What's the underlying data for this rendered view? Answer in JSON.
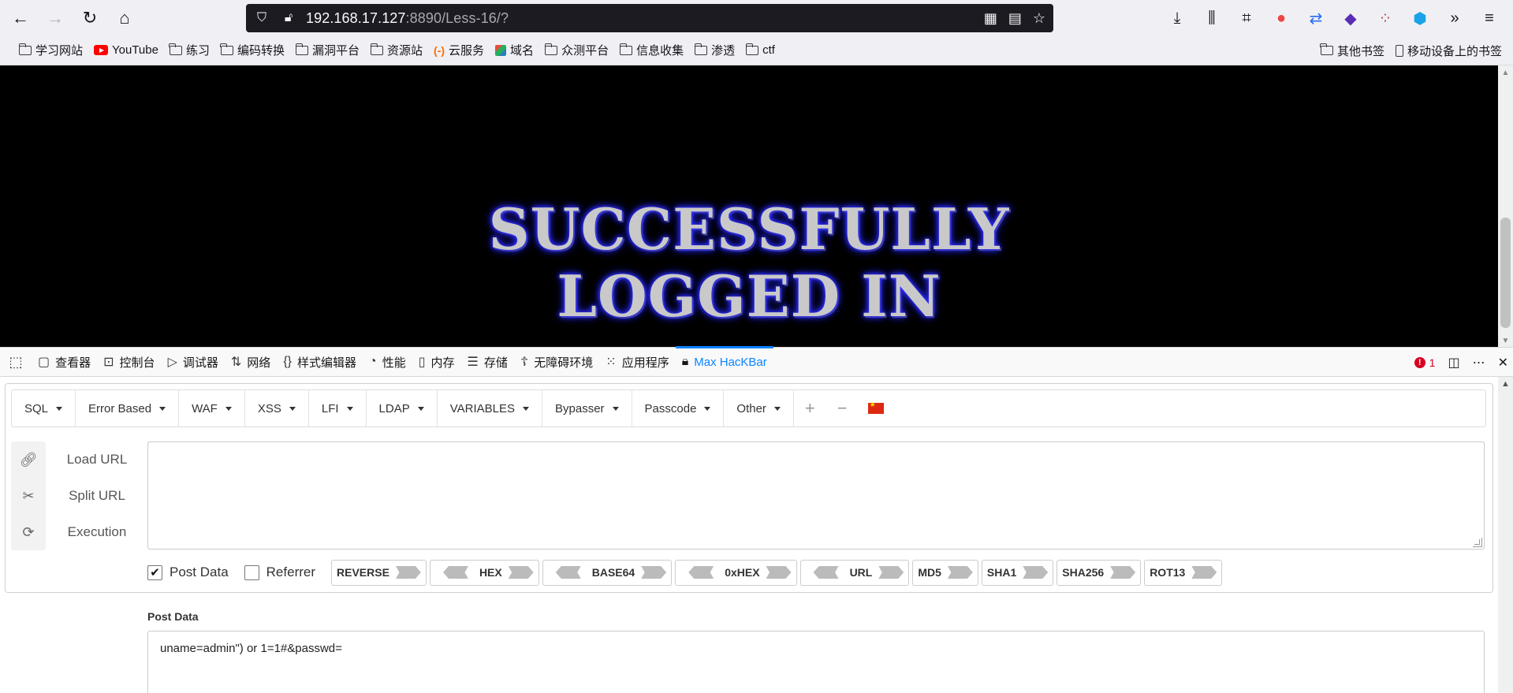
{
  "browser": {
    "url_host": "192.168.17.127",
    "url_rest": ":8890/Less-16/?"
  },
  "bookmarks": {
    "left": [
      {
        "label": "学习网站",
        "icon": "folder-icon"
      },
      {
        "label": "YouTube",
        "icon": "youtube-icon"
      },
      {
        "label": "练习",
        "icon": "folder-icon"
      },
      {
        "label": "编码转换",
        "icon": "folder-icon"
      },
      {
        "label": "漏洞平台",
        "icon": "folder-icon"
      },
      {
        "label": "资源站",
        "icon": "folder-icon"
      },
      {
        "label": "云服务",
        "icon": "cloud-icon"
      },
      {
        "label": "域名",
        "icon": "cube-icon"
      },
      {
        "label": "众测平台",
        "icon": "folder-icon"
      },
      {
        "label": "信息收集",
        "icon": "folder-icon"
      },
      {
        "label": "渗透",
        "icon": "folder-icon"
      },
      {
        "label": "ctf",
        "icon": "folder-icon"
      }
    ],
    "other": "其他书签",
    "mobile": "移动设备上的书签"
  },
  "page": {
    "line1": "SUCCESSFULLY",
    "line2": "LOGGED IN"
  },
  "devtools": {
    "tabs": [
      {
        "label": "查看器",
        "icon": "inspector-icon"
      },
      {
        "label": "控制台",
        "icon": "console-icon"
      },
      {
        "label": "调试器",
        "icon": "debugger-icon"
      },
      {
        "label": "网络",
        "icon": "network-icon"
      },
      {
        "label": "样式编辑器",
        "icon": "style-editor-icon"
      },
      {
        "label": "性能",
        "icon": "performance-icon"
      },
      {
        "label": "内存",
        "icon": "memory-icon"
      },
      {
        "label": "存储",
        "icon": "storage-icon"
      },
      {
        "label": "无障碍环境",
        "icon": "accessibility-icon"
      },
      {
        "label": "应用程序",
        "icon": "application-icon"
      },
      {
        "label": "Max HacKBar",
        "icon": "hackbar-icon"
      }
    ],
    "active_tab": "Max HacKBar",
    "error_count": "1",
    "accent_color": "#0a84ff"
  },
  "hackbar": {
    "menu": [
      "SQL",
      "Error Based",
      "WAF",
      "XSS",
      "LFI",
      "LDAP",
      "VARIABLES",
      "Bypasser",
      "Passcode",
      "Other"
    ],
    "actions": [
      {
        "label": "Load URL",
        "icon": "link-icon"
      },
      {
        "label": "Split URL",
        "icon": "scissors-icon"
      },
      {
        "label": "Execution",
        "icon": "refresh-icon"
      }
    ],
    "url_value": "",
    "post_data_checked": true,
    "post_data_label": "Post Data",
    "referrer_checked": false,
    "referrer_label": "Referrer",
    "encoders": [
      {
        "label": "REVERSE",
        "left_arrow": false
      },
      {
        "label": "HEX",
        "left_arrow": true
      },
      {
        "label": "BASE64",
        "left_arrow": true
      },
      {
        "label": "0xHEX",
        "left_arrow": true
      },
      {
        "label": "URL",
        "left_arrow": true
      },
      {
        "label": "MD5",
        "left_arrow": false
      },
      {
        "label": "SHA1",
        "left_arrow": false
      },
      {
        "label": "SHA256",
        "left_arrow": false
      },
      {
        "label": "ROT13",
        "left_arrow": false
      }
    ],
    "post_section_label": "Post Data",
    "post_value": "uname=admin\") or 1=1#&passwd="
  }
}
